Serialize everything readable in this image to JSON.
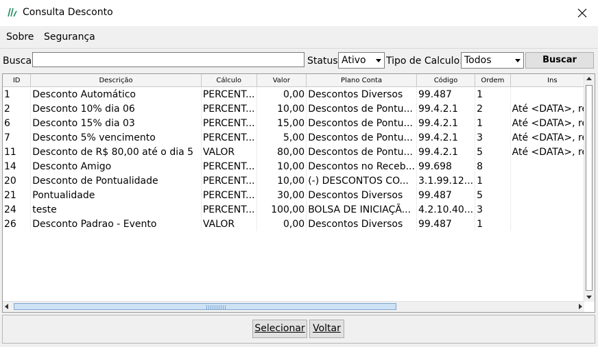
{
  "window": {
    "title": "Consulta Desconto"
  },
  "menu": [
    "Sobre",
    "Segurança"
  ],
  "toolbar": {
    "search_label": "Busca:",
    "search_value": "",
    "status_label": "Status:",
    "status_value": "Ativo",
    "tipo_label": "Tipo de Calculo:",
    "tipo_value": "Todos",
    "buscar_label": "Buscar"
  },
  "table": {
    "headers": [
      "ID",
      "Descrição",
      "Cálculo",
      "Valor",
      "Plano Conta",
      "Código",
      "Ordem",
      "Ins"
    ],
    "rows": [
      [
        "1",
        "Desconto Automático",
        "PERCENT...",
        "0,00",
        "Descontos Diversos",
        "99.487",
        "1",
        ""
      ],
      [
        "2",
        "Desconto 10% dia 06",
        "PERCENT...",
        "10,00",
        "Descontos de Pontu...",
        "99.4.2.1",
        "2",
        "Até <DATA>, re"
      ],
      [
        "6",
        "Desconto 15% dia 03",
        "PERCENT...",
        "15,00",
        "Descontos de Pontu...",
        "99.4.2.1",
        "1",
        "Até <DATA>, re"
      ],
      [
        "7",
        "Desconto 5% vencimento",
        "PERCENT...",
        "5,00",
        "Descontos de Pontu...",
        "99.4.2.1",
        "3",
        "Até <DATA>, re"
      ],
      [
        "11",
        "Desconto de R$ 80,00 até o dia 5",
        "VALOR",
        "80,00",
        "Descontos de Pontu...",
        "99.4.2.1",
        "5",
        "Até <DATA>, re"
      ],
      [
        "14",
        "Desconto Amigo",
        "PERCENT...",
        "10,00",
        "Descontos no Receb...",
        "99.698",
        "8",
        ""
      ],
      [
        "20",
        "Desconto de Pontualidade",
        "PERCENT...",
        "10,00",
        "(-) DESCONTOS CO...",
        "3.1.99.12...",
        "1",
        ""
      ],
      [
        "21",
        "Pontualidade",
        "PERCENT...",
        "30,00",
        "Descontos Diversos",
        "99.487",
        "5",
        ""
      ],
      [
        "24",
        "teste",
        "PERCENT...",
        "100,00",
        "BOLSA DE INICIAÇÃ...",
        "4.2.10.40...",
        "3",
        ""
      ],
      [
        "26",
        "Desconto Padrao - Evento",
        "VALOR",
        "0,00",
        "Descontos Diversos",
        "99.487",
        "1",
        ""
      ]
    ]
  },
  "footer": {
    "selecionar_label": "Selecionar",
    "voltar_label": "Voltar"
  },
  "colors": {
    "accent": "#1e8a5a",
    "header_bg": "#f4f4f4",
    "button_bg": "#e1e1e1"
  }
}
